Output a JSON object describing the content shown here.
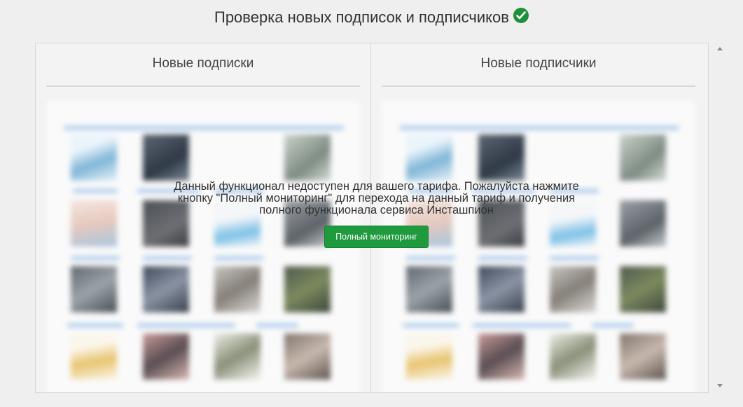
{
  "header": {
    "title": "Проверка новых подписок и подписчиков",
    "icon": "check-circle-icon"
  },
  "columns": [
    {
      "title": "Новые подписки"
    },
    {
      "title": "Новые подписчики"
    }
  ],
  "overlay": {
    "message": "Данный функционал недоступен для вашего тарифа. Пожалуйста нажмите кнопку \"Полный мониторинг\" для перехода на данный тариф и получения полного функционала сервиса Инсташпион",
    "button_label": "Полный мониторинг"
  },
  "colors": {
    "accent": "#1f9a3d",
    "check": "#1e8f3a"
  }
}
